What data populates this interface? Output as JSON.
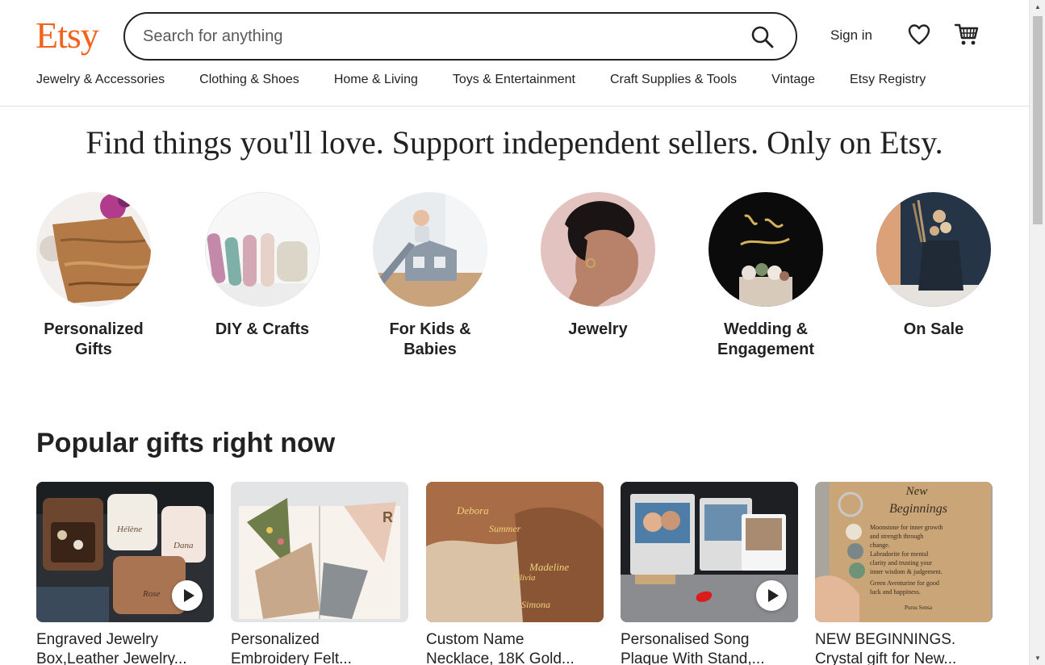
{
  "header": {
    "logo": "Etsy",
    "search_placeholder": "Search for anything",
    "signin_label": "Sign in"
  },
  "nav": [
    "Jewelry & Accessories",
    "Clothing & Shoes",
    "Home & Living",
    "Toys & Entertainment",
    "Craft Supplies & Tools",
    "Vintage",
    "Etsy Registry"
  ],
  "hero": {
    "tagline": "Find things you'll love. Support independent sellers. Only on Etsy."
  },
  "categories": [
    {
      "line1": "Personalized",
      "line2": "Gifts"
    },
    {
      "line1": "DIY & Crafts",
      "line2": ""
    },
    {
      "line1": "For Kids &",
      "line2": "Babies"
    },
    {
      "line1": "Jewelry",
      "line2": ""
    },
    {
      "line1": "Wedding &",
      "line2": "Engagement"
    },
    {
      "line1": "On Sale",
      "line2": ""
    }
  ],
  "popular": {
    "title": "Popular gifts right now",
    "items": [
      {
        "line1": "Engraved Jewelry",
        "line2": "Box,Leather Jewelry..."
      },
      {
        "line1": "Personalized",
        "line2": "Embroidery Felt..."
      },
      {
        "line1": "Custom Name",
        "line2": "Necklace, 18K Gold..."
      },
      {
        "line1": "Personalised Song",
        "line2": "Plaque With Stand,..."
      },
      {
        "line1": "NEW BEGINNINGS.",
        "line2": "Crystal gift for New..."
      }
    ],
    "image_text": {
      "box_names": [
        "Hélène",
        "Dana",
        "Rose"
      ],
      "necklace_names": [
        "Debora",
        "Summer",
        "Madeline",
        "Olivia",
        "Simona"
      ],
      "card_lines": [
        "New",
        "Beginnings",
        "Moonstone for inner growth",
        "and strength through",
        "change.",
        "Labradorite for mental",
        "clarity and trusting your",
        "inner wisdom & judgement.",
        "Green Aventurine for good",
        "luck and happiness.",
        "Purus Sensa"
      ]
    }
  },
  "colors": {
    "brand": "#f1641e",
    "text": "#222222"
  }
}
